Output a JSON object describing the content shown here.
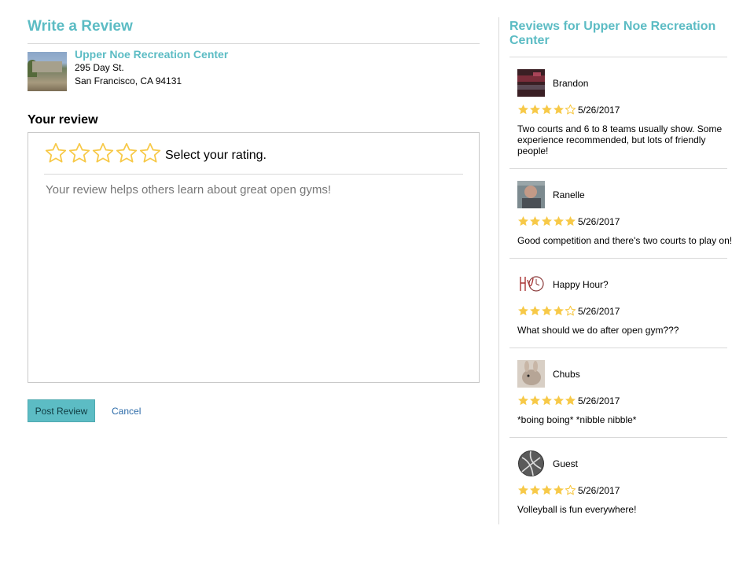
{
  "write": {
    "title": "Write a Review",
    "venue": {
      "name": "Upper Noe Recreation Center",
      "address_line1": "295 Day St.",
      "address_line2": "San Francisco, CA 94131"
    },
    "your_review_label": "Your review",
    "rating_hint": "Select your rating.",
    "rating_value": 0,
    "rating_max": 5,
    "textarea_placeholder": "Your review helps others learn about great open gyms!",
    "post_button": "Post Review",
    "cancel_link": "Cancel"
  },
  "reviews_panel": {
    "title": "Reviews for Upper Noe Recreation Center",
    "reviews": [
      {
        "user": "Brandon",
        "rating": 4,
        "date": "5/26/2017",
        "text": "Two courts and 6 to 8 teams usually show. Some experience recommended, but lots of friendly people!",
        "avatar": "photo-avatar"
      },
      {
        "user": "Ranelle",
        "rating": 5,
        "date": "5/26/2017",
        "text": "Good competition and there's two courts to play on!",
        "avatar": "photo-avatar"
      },
      {
        "user": "Happy Hour?",
        "rating": 4,
        "date": "5/26/2017",
        "text": "What should we do after open gym???",
        "avatar": "clock-logo-avatar"
      },
      {
        "user": "Chubs",
        "rating": 5,
        "date": "5/26/2017",
        "text": "*boing boing* *nibble nibble*",
        "avatar": "bunny-photo-avatar"
      },
      {
        "user": "Guest",
        "rating": 4,
        "date": "5/26/2017",
        "text": "Volleyball is fun everywhere!",
        "avatar": "volleyball-icon"
      }
    ]
  },
  "colors": {
    "accent": "#5cbcc4",
    "star": "#f7c948",
    "link": "#2b6aa8",
    "divider": "#d9d9d9"
  }
}
